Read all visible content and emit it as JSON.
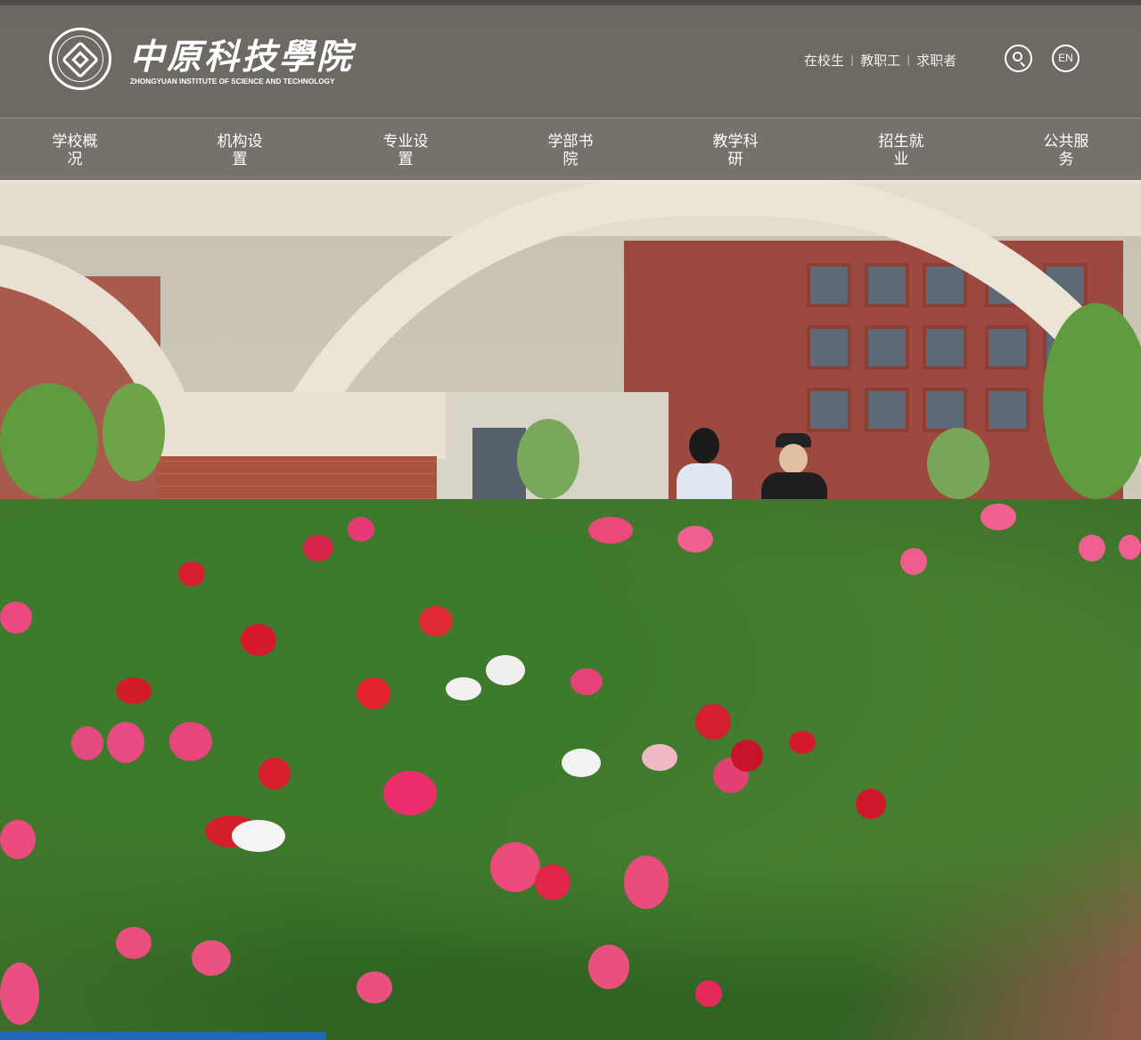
{
  "header": {
    "logo_cn": "中原科技學院",
    "logo_en": "ZHONGYUAN INSTITUTE OF SCIENCE AND TECHNOLOGY",
    "quick_links": [
      "在校生",
      "教职工",
      "求职者"
    ],
    "lang_label": "EN",
    "search_icon": "search-icon"
  },
  "nav": {
    "items": [
      "学校概况",
      "机构设置",
      "专业设置",
      "学部书院",
      "教学科研",
      "招生就业",
      "公共服务"
    ]
  },
  "colors": {
    "header_bg": "#605c56",
    "nav_bg": "#706c65",
    "accent_bar": "#1f67b8"
  }
}
